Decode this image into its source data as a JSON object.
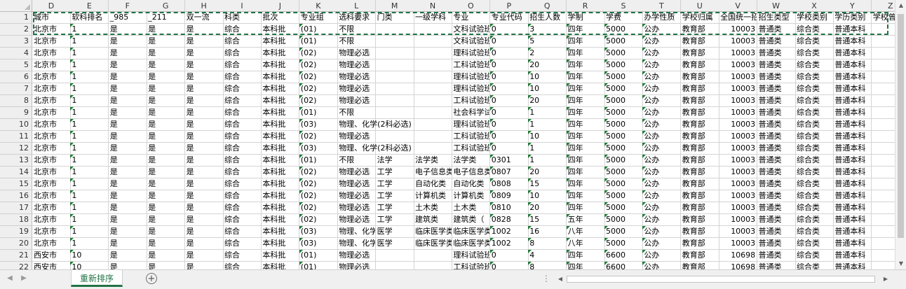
{
  "columns": [
    "D",
    "E",
    "F",
    "G",
    "H",
    "I",
    "J",
    "K",
    "L",
    "M",
    "N",
    "O",
    "P",
    "Q",
    "R",
    "S",
    "T",
    "U",
    "V",
    "W",
    "X",
    "Y",
    "Z"
  ],
  "header_row": [
    "城市",
    "软科排名",
    "_985",
    "_211",
    "双一流",
    "科类",
    "批次",
    "专业组",
    "选科要求",
    "门类",
    "一级学科",
    "专业",
    "专业代码",
    "招生人数",
    "学制",
    "学费",
    "办学性质",
    "学校归属",
    "全国统一招生代码",
    "招生类型",
    "学校类别",
    "学历类别",
    "学校曾用名"
  ],
  "rows": [
    {
      "num": "2",
      "cells": [
        "北京市",
        "1",
        "是",
        "是",
        "是",
        "综合",
        "本科批",
        "(01)",
        "不限",
        "",
        "",
        "文科试验班",
        "0",
        "3",
        "四年",
        "5000",
        "公办",
        "教育部",
        "10003",
        "普通类",
        "综合类",
        "普通本科",
        ""
      ]
    },
    {
      "num": "3",
      "cells": [
        "北京市",
        "1",
        "是",
        "是",
        "是",
        "综合",
        "本科批",
        "(01)",
        "不限",
        "",
        "",
        "文科试验班",
        "0",
        "5",
        "四年",
        "5000",
        "公办",
        "教育部",
        "10003",
        "普通类",
        "综合类",
        "普通本科",
        ""
      ]
    },
    {
      "num": "4",
      "cells": [
        "北京市",
        "1",
        "是",
        "是",
        "是",
        "综合",
        "本科批",
        "(02)",
        "物理必选",
        "",
        "",
        "理科试验班",
        "0",
        "2",
        "四年",
        "5000",
        "公办",
        "教育部",
        "10003",
        "普通类",
        "综合类",
        "普通本科",
        ""
      ]
    },
    {
      "num": "5",
      "cells": [
        "北京市",
        "1",
        "是",
        "是",
        "是",
        "综合",
        "本科批",
        "(02)",
        "物理必选",
        "",
        "",
        "工科试验班",
        "0",
        "20",
        "四年",
        "5000",
        "公办",
        "教育部",
        "10003",
        "普通类",
        "综合类",
        "普通本科",
        ""
      ]
    },
    {
      "num": "6",
      "cells": [
        "北京市",
        "1",
        "是",
        "是",
        "是",
        "综合",
        "本科批",
        "(02)",
        "物理必选",
        "",
        "",
        "理科试验班",
        "0",
        "10",
        "四年",
        "5000",
        "公办",
        "教育部",
        "10003",
        "普通类",
        "综合类",
        "普通本科",
        ""
      ]
    },
    {
      "num": "7",
      "cells": [
        "北京市",
        "1",
        "是",
        "是",
        "是",
        "综合",
        "本科批",
        "(02)",
        "物理必选",
        "",
        "",
        "理科试验班",
        "0",
        "10",
        "四年",
        "5000",
        "公办",
        "教育部",
        "10003",
        "普通类",
        "综合类",
        "普通本科",
        ""
      ]
    },
    {
      "num": "8",
      "cells": [
        "北京市",
        "1",
        "是",
        "是",
        "是",
        "综合",
        "本科批",
        "(02)",
        "物理必选",
        "",
        "",
        "工科试验班",
        "0",
        "20",
        "四年",
        "5000",
        "公办",
        "教育部",
        "10003",
        "普通类",
        "综合类",
        "普通本科",
        ""
      ]
    },
    {
      "num": "9",
      "cells": [
        "北京市",
        "1",
        "是",
        "是",
        "是",
        "综合",
        "本科批",
        "(01)",
        "不限",
        "",
        "",
        "社会科学试验班",
        "0",
        "1",
        "四年",
        "5000",
        "公办",
        "教育部",
        "10003",
        "普通类",
        "综合类",
        "普通本科",
        ""
      ]
    },
    {
      "num": "10",
      "cells": [
        "北京市",
        "1",
        "是",
        "是",
        "是",
        "综合",
        "本科批",
        "(03)",
        "物理、化学(2科必选)",
        "",
        "",
        "理科试验班",
        "0",
        "1",
        "四年",
        "5000",
        "公办",
        "教育部",
        "10003",
        "普通类",
        "综合类",
        "普通本科",
        ""
      ]
    },
    {
      "num": "11",
      "cells": [
        "北京市",
        "1",
        "是",
        "是",
        "是",
        "综合",
        "本科批",
        "(02)",
        "物理必选",
        "",
        "",
        "工科试验班",
        "0",
        "10",
        "四年",
        "5000",
        "公办",
        "教育部",
        "10003",
        "普通类",
        "综合类",
        "普通本科",
        ""
      ]
    },
    {
      "num": "12",
      "cells": [
        "北京市",
        "1",
        "是",
        "是",
        "是",
        "综合",
        "本科批",
        "(03)",
        "物理、化学(2科必选)",
        "",
        "",
        "工科试验班",
        "0",
        "1",
        "四年",
        "5000",
        "公办",
        "教育部",
        "10003",
        "普通类",
        "综合类",
        "普通本科",
        ""
      ]
    },
    {
      "num": "13",
      "cells": [
        "北京市",
        "1",
        "是",
        "是",
        "是",
        "综合",
        "本科批",
        "(01)",
        "不限",
        "法学",
        "法学类",
        "法学类",
        "0301",
        "1",
        "四年",
        "5000",
        "公办",
        "教育部",
        "10003",
        "普通类",
        "综合类",
        "普通本科",
        ""
      ]
    },
    {
      "num": "14",
      "cells": [
        "北京市",
        "1",
        "是",
        "是",
        "是",
        "综合",
        "本科批",
        "(02)",
        "物理必选",
        "工学",
        "电子信息类",
        "电子信息类",
        "0807",
        "20",
        "四年",
        "5000",
        "公办",
        "教育部",
        "10003",
        "普通类",
        "综合类",
        "普通本科",
        ""
      ]
    },
    {
      "num": "15",
      "cells": [
        "北京市",
        "1",
        "是",
        "是",
        "是",
        "综合",
        "本科批",
        "(02)",
        "物理必选",
        "工学",
        "自动化类",
        "自动化类",
        "0808",
        "15",
        "四年",
        "5000",
        "公办",
        "教育部",
        "10003",
        "普通类",
        "综合类",
        "普通本科",
        ""
      ]
    },
    {
      "num": "16",
      "cells": [
        "北京市",
        "1",
        "是",
        "是",
        "是",
        "综合",
        "本科批",
        "(02)",
        "物理必选",
        "工学",
        "计算机类",
        "计算机类",
        "0809",
        "10",
        "四年",
        "5000",
        "公办",
        "教育部",
        "10003",
        "普通类",
        "综合类",
        "普通本科",
        ""
      ]
    },
    {
      "num": "17",
      "cells": [
        "北京市",
        "1",
        "是",
        "是",
        "是",
        "综合",
        "本科批",
        "(02)",
        "物理必选",
        "工学",
        "土木类",
        "土木类",
        "0810",
        "20",
        "四年",
        "5000",
        "公办",
        "教育部",
        "10003",
        "普通类",
        "综合类",
        "普通本科",
        ""
      ]
    },
    {
      "num": "18",
      "cells": [
        "北京市",
        "1",
        "是",
        "是",
        "是",
        "综合",
        "本科批",
        "(02)",
        "物理必选",
        "工学",
        "建筑类",
        "建筑类（",
        "0828",
        "15",
        "五年",
        "5000",
        "公办",
        "教育部",
        "10003",
        "普通类",
        "综合类",
        "普通本科",
        ""
      ]
    },
    {
      "num": "19",
      "cells": [
        "北京市",
        "1",
        "是",
        "是",
        "是",
        "综合",
        "本科批",
        "(03)",
        "物理、化学",
        "医学",
        "临床医学类",
        "临床医学类",
        "1002",
        "16",
        "八年",
        "5000",
        "公办",
        "教育部",
        "10003",
        "普通类",
        "综合类",
        "普通本科",
        ""
      ]
    },
    {
      "num": "20",
      "cells": [
        "北京市",
        "1",
        "是",
        "是",
        "是",
        "综合",
        "本科批",
        "(03)",
        "物理、化学",
        "医学",
        "临床医学类",
        "临床医学类",
        "1002",
        "8",
        "八年",
        "5000",
        "公办",
        "教育部",
        "10003",
        "普通类",
        "综合类",
        "普通本科",
        ""
      ]
    },
    {
      "num": "21",
      "cells": [
        "西安市",
        "10",
        "是",
        "是",
        "是",
        "综合",
        "本科批",
        "(01)",
        "物理必选",
        "",
        "",
        "理科试验班",
        "0",
        "4",
        "四年",
        "6600",
        "公办",
        "教育部",
        "10698",
        "普通类",
        "综合类",
        "普通本科",
        ""
      ]
    },
    {
      "num": "22",
      "cells": [
        "西安市",
        "10",
        "是",
        "是",
        "是",
        "综合",
        "本科批",
        "(01)",
        "物理必选",
        "",
        "",
        "工科试验班",
        "0",
        "8",
        "四年",
        "6600",
        "公办",
        "教育部",
        "10698",
        "普通类",
        "综合类",
        "普通本科",
        ""
      ]
    }
  ],
  "sheet_tab": "重新排序",
  "add_sheet_symbol": "+",
  "more_symbol": "⋮"
}
